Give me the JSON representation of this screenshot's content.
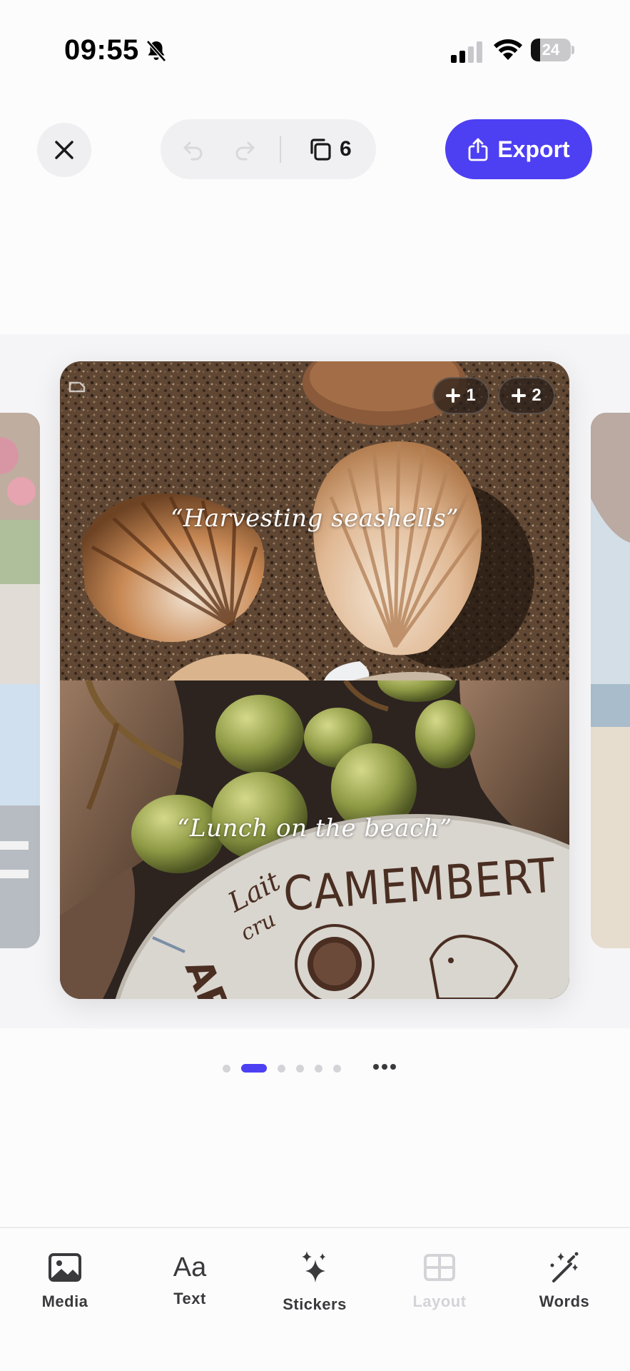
{
  "status_bar": {
    "time": "09:55",
    "battery_percent": "24",
    "battery_level": 0.24
  },
  "toolbar": {
    "close_icon": "close-icon",
    "undo_icon": "undo-icon",
    "redo_icon": "redo-icon",
    "pages_icon": "pages-icon",
    "page_count": "6",
    "export_label": "Export",
    "export_icon": "share-icon",
    "accent_color": "#4d3ff2"
  },
  "canvas": {
    "top_photo": {
      "subject": "seashells",
      "caption": "“Harvesting seashells”"
    },
    "bottom_photo": {
      "subject": "grapes-and-camembert",
      "caption": "“Lunch on the beach”",
      "printed_text": [
        "CAMEMBERT DE N",
        "Lait cru",
        "APP"
      ]
    },
    "add_chips": [
      {
        "label": "1",
        "icon": "plus-icon"
      },
      {
        "label": "2",
        "icon": "plus-icon"
      }
    ]
  },
  "pagination": {
    "total_dots": 6,
    "active_index": 1,
    "more_icon": "more-dots-icon"
  },
  "tabbar": {
    "items": [
      {
        "label": "Media",
        "icon": "image-icon",
        "enabled": true
      },
      {
        "label": "Text",
        "icon": "text-aa-icon",
        "glyph": "Aa",
        "enabled": true
      },
      {
        "label": "Stickers",
        "icon": "sparkles-icon",
        "enabled": true
      },
      {
        "label": "Layout",
        "icon": "layout-grid-icon",
        "enabled": false
      },
      {
        "label": "Words",
        "icon": "magic-wand-icon",
        "enabled": true
      }
    ]
  }
}
